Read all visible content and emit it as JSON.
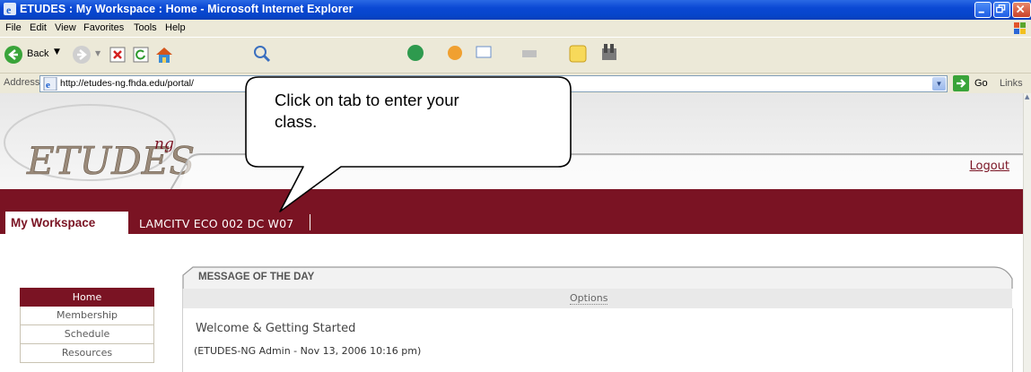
{
  "window": {
    "title": "ETUDES : My Workspace : Home - Microsoft Internet Explorer"
  },
  "menu": [
    "File",
    "Edit",
    "View",
    "Favorites",
    "Tools",
    "Help"
  ],
  "toolbar": {
    "back_label": "Back"
  },
  "address": {
    "label": "Address",
    "url": "http://etudes-ng.fhda.edu/portal/",
    "go_label": "Go",
    "links_label": "Links"
  },
  "callout": {
    "line1": "Click on tab to enter your",
    "line2": "class."
  },
  "header": {
    "logo": "ETUDES ng",
    "logout": "Logout"
  },
  "tabs": {
    "active": "My Workspace",
    "other": "LAMCITV ECO 002 DC W07"
  },
  "nav": [
    "Home",
    "Membership",
    "Schedule",
    "Resources"
  ],
  "motd": {
    "title": "MESSAGE OF THE DAY",
    "options": "Options",
    "message_title": "Welcome & Getting Started",
    "byline": "(ETUDES-NG Admin - Nov 13, 2006 10:16 pm)"
  },
  "colors": {
    "brand": "#7a1323",
    "xp_title": "#0a48d4"
  }
}
